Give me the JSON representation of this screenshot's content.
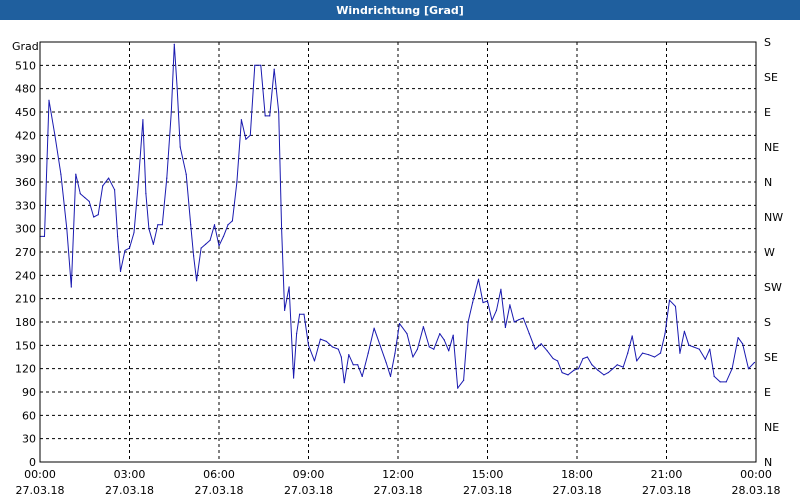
{
  "window": {
    "title": "Windrichtung [Grad]"
  },
  "chart_data": {
    "type": "line",
    "title": "Windrichtung [Grad]",
    "ylabel": "Grad",
    "ylim": [
      0,
      540
    ],
    "yticks": [
      0,
      30,
      60,
      90,
      120,
      150,
      180,
      210,
      240,
      270,
      300,
      330,
      360,
      390,
      420,
      450,
      480,
      510
    ],
    "right_axis_labels": [
      "N",
      "NE",
      "E",
      "SE",
      "S",
      "SW",
      "W",
      "NW",
      "N",
      "NE",
      "E",
      "SE",
      "S"
    ],
    "right_axis_values": [
      0,
      45,
      90,
      135,
      180,
      225,
      270,
      315,
      360,
      405,
      450,
      495,
      540
    ],
    "xlim": [
      0,
      24
    ],
    "xticks": [
      {
        "x": 0,
        "time": "00:00",
        "date": "27.03.18"
      },
      {
        "x": 3,
        "time": "03:00",
        "date": "27.03.18"
      },
      {
        "x": 6,
        "time": "06:00",
        "date": "27.03.18"
      },
      {
        "x": 9,
        "time": "09:00",
        "date": "27.03.18"
      },
      {
        "x": 12,
        "time": "12:00",
        "date": "27.03.18"
      },
      {
        "x": 15,
        "time": "15:00",
        "date": "27.03.18"
      },
      {
        "x": 18,
        "time": "18:00",
        "date": "27.03.18"
      },
      {
        "x": 21,
        "time": "21:00",
        "date": "27.03.18"
      },
      {
        "x": 24,
        "time": "00:00",
        "date": "28.03.18"
      }
    ],
    "grid": true,
    "line_color": "#1a1ab0",
    "series": [
      {
        "values": [
          [
            0.0,
            290
          ],
          [
            0.15,
            290
          ],
          [
            0.3,
            465
          ],
          [
            0.5,
            420
          ],
          [
            0.7,
            370
          ],
          [
            0.9,
            300
          ],
          [
            1.05,
            225
          ],
          [
            1.2,
            370
          ],
          [
            1.35,
            345
          ],
          [
            1.5,
            340
          ],
          [
            1.65,
            335
          ],
          [
            1.8,
            315
          ],
          [
            1.95,
            318
          ],
          [
            2.1,
            355
          ],
          [
            2.3,
            365
          ],
          [
            2.5,
            350
          ],
          [
            2.6,
            290
          ],
          [
            2.7,
            245
          ],
          [
            2.85,
            272
          ],
          [
            3.0,
            275
          ],
          [
            3.15,
            295
          ],
          [
            3.3,
            360
          ],
          [
            3.45,
            440
          ],
          [
            3.55,
            345
          ],
          [
            3.65,
            300
          ],
          [
            3.8,
            280
          ],
          [
            3.95,
            305
          ],
          [
            4.1,
            305
          ],
          [
            4.25,
            365
          ],
          [
            4.4,
            450
          ],
          [
            4.5,
            537
          ],
          [
            4.6,
            480
          ],
          [
            4.7,
            405
          ],
          [
            4.9,
            370
          ],
          [
            5.05,
            305
          ],
          [
            5.15,
            265
          ],
          [
            5.25,
            233
          ],
          [
            5.4,
            275
          ],
          [
            5.55,
            280
          ],
          [
            5.7,
            285
          ],
          [
            5.85,
            305
          ],
          [
            6.0,
            278
          ],
          [
            6.15,
            290
          ],
          [
            6.3,
            305
          ],
          [
            6.45,
            310
          ],
          [
            6.6,
            360
          ],
          [
            6.75,
            440
          ],
          [
            6.9,
            415
          ],
          [
            7.05,
            420
          ],
          [
            7.2,
            510
          ],
          [
            7.4,
            510
          ],
          [
            7.55,
            445
          ],
          [
            7.7,
            445
          ],
          [
            7.85,
            505
          ],
          [
            8.0,
            450
          ],
          [
            8.1,
            300
          ],
          [
            8.2,
            195
          ],
          [
            8.35,
            225
          ],
          [
            8.5,
            108
          ],
          [
            8.6,
            165
          ],
          [
            8.7,
            190
          ],
          [
            8.85,
            190
          ],
          [
            9.0,
            150
          ],
          [
            9.2,
            130
          ],
          [
            9.4,
            158
          ],
          [
            9.6,
            155
          ],
          [
            9.8,
            148
          ],
          [
            10.0,
            145
          ],
          [
            10.1,
            135
          ],
          [
            10.2,
            102
          ],
          [
            10.35,
            138
          ],
          [
            10.5,
            125
          ],
          [
            10.65,
            125
          ],
          [
            10.8,
            110
          ],
          [
            11.0,
            140
          ],
          [
            11.2,
            172
          ],
          [
            11.4,
            150
          ],
          [
            11.6,
            128
          ],
          [
            11.75,
            110
          ],
          [
            11.9,
            140
          ],
          [
            12.05,
            178
          ],
          [
            12.3,
            165
          ],
          [
            12.5,
            135
          ],
          [
            12.65,
            145
          ],
          [
            12.85,
            174
          ],
          [
            13.05,
            148
          ],
          [
            13.2,
            145
          ],
          [
            13.4,
            165
          ],
          [
            13.55,
            157
          ],
          [
            13.7,
            143
          ],
          [
            13.85,
            163
          ],
          [
            14.0,
            95
          ],
          [
            14.2,
            105
          ],
          [
            14.35,
            180
          ],
          [
            14.5,
            205
          ],
          [
            14.7,
            235
          ],
          [
            14.85,
            205
          ],
          [
            15.0,
            207
          ],
          [
            15.15,
            182
          ],
          [
            15.3,
            195
          ],
          [
            15.45,
            222
          ],
          [
            15.6,
            173
          ],
          [
            15.75,
            202
          ],
          [
            15.9,
            180
          ],
          [
            16.05,
            183
          ],
          [
            16.2,
            185
          ],
          [
            16.4,
            165
          ],
          [
            16.6,
            145
          ],
          [
            16.8,
            152
          ],
          [
            17.0,
            143
          ],
          [
            17.2,
            133
          ],
          [
            17.35,
            130
          ],
          [
            17.5,
            115
          ],
          [
            17.7,
            112
          ],
          [
            17.9,
            118
          ],
          [
            18.05,
            120
          ],
          [
            18.2,
            133
          ],
          [
            18.35,
            135
          ],
          [
            18.5,
            125
          ],
          [
            18.7,
            118
          ],
          [
            18.9,
            112
          ],
          [
            19.05,
            115
          ],
          [
            19.2,
            120
          ],
          [
            19.35,
            125
          ],
          [
            19.55,
            122
          ],
          [
            19.7,
            140
          ],
          [
            19.85,
            162
          ],
          [
            20.0,
            130
          ],
          [
            20.2,
            140
          ],
          [
            20.4,
            138
          ],
          [
            20.6,
            135
          ],
          [
            20.8,
            140
          ],
          [
            20.95,
            165
          ],
          [
            21.1,
            208
          ],
          [
            21.3,
            200
          ],
          [
            21.45,
            140
          ],
          [
            21.6,
            168
          ],
          [
            21.75,
            150
          ],
          [
            21.9,
            148
          ],
          [
            22.1,
            145
          ],
          [
            22.3,
            132
          ],
          [
            22.45,
            145
          ],
          [
            22.6,
            110
          ],
          [
            22.8,
            103
          ],
          [
            23.0,
            103
          ],
          [
            23.2,
            120
          ],
          [
            23.4,
            160
          ],
          [
            23.55,
            152
          ],
          [
            23.75,
            120
          ],
          [
            23.95,
            128
          ]
        ]
      }
    ]
  }
}
